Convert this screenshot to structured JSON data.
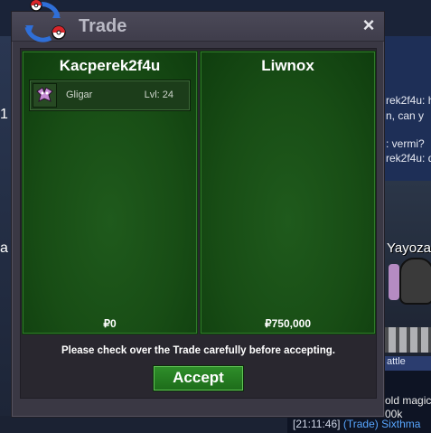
{
  "background": {
    "chat_lines": [
      "rek2f4u: h",
      "n, can y",
      ": vermi?",
      "rek2f4u: d"
    ],
    "left_number": "1",
    "left_letter": "a",
    "player_name": "Yayoza",
    "battle_text": "attle",
    "lower_lines": [
      "old magic",
      "00k"
    ],
    "log": {
      "time": "[21:11:46]",
      "channel": "(Trade)",
      "name": "Sixthma"
    }
  },
  "trade_window": {
    "title": "Trade",
    "close_label": "×",
    "left_panel": {
      "player": "Kacperek2f4u",
      "items": [
        {
          "name": "Gligar",
          "level": "Lvl: 24",
          "icon": "gligar-icon"
        }
      ],
      "money": "₽0"
    },
    "right_panel": {
      "player": "Liwnox",
      "items": [],
      "money": "₽750,000"
    },
    "notice": "Please check over the Trade carefully before accepting.",
    "accept_label": "Accept"
  },
  "colors": {
    "panel_green": "#184d15",
    "accept_green": "#2f8f2a",
    "window_bg": "#3a3844",
    "log_trade": "#58a6ff"
  }
}
